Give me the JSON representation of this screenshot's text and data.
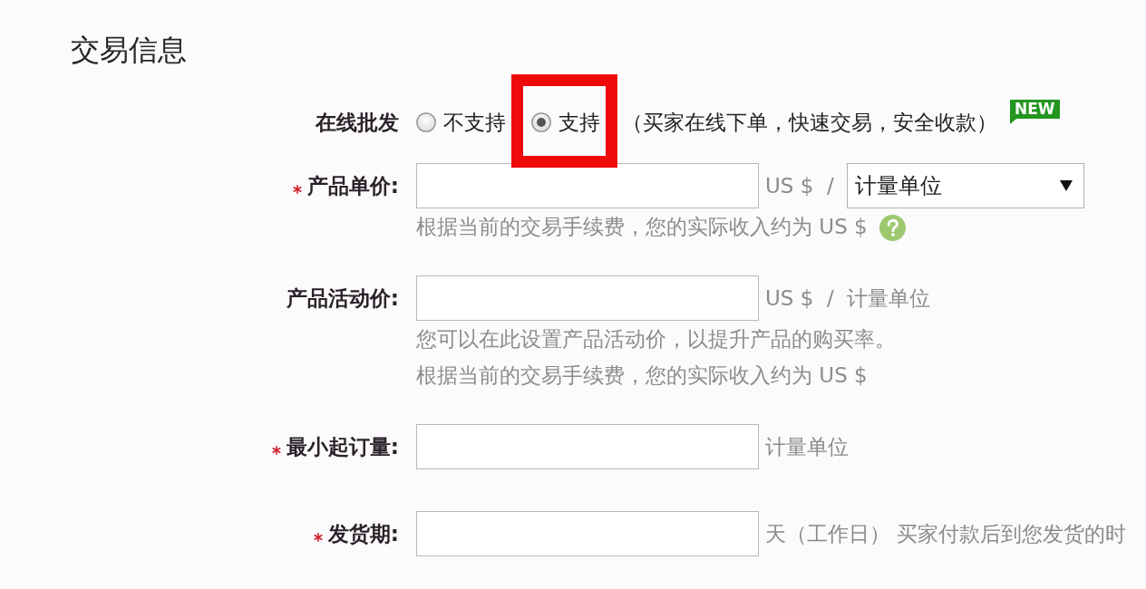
{
  "section_title": "交易信息",
  "annotations": [
    {
      "kind": "frame"
    }
  ],
  "online_wholesale": {
    "label": "在线批发",
    "options": [
      {
        "label": "不支持",
        "selected": false
      },
      {
        "label": "支持",
        "selected": true
      }
    ],
    "description": "（买家在线下单，快速交易，安全收款）",
    "badge": "NEW"
  },
  "fields": [
    {
      "label": "产品单价:",
      "required": true,
      "after": [
        {
          "kind": "text",
          "text": "US $  /"
        },
        {
          "kind": "select",
          "value": "计量单位"
        }
      ],
      "hints": [
        {
          "text": "根据当前的交易手续费，您的实际收入约为 US $",
          "help": true
        }
      ]
    },
    {
      "label": "产品活动价:",
      "required": false,
      "after": [
        {
          "kind": "text",
          "text": "US $  /  计量单位"
        }
      ],
      "hints": [
        {
          "text": "您可以在此设置产品活动价，以提升产品的购买率。",
          "help": false
        },
        {
          "text": "根据当前的交易手续费，您的实际收入约为 US $",
          "help": false
        }
      ]
    },
    {
      "label": "最小起订量:",
      "required": true,
      "after": [
        {
          "kind": "text",
          "text": "计量单位"
        }
      ]
    },
    {
      "label": "发货期:",
      "required": true,
      "after": [
        {
          "kind": "text",
          "text": "天（工作日） 买家付款后到您发货的时"
        }
      ]
    }
  ]
}
